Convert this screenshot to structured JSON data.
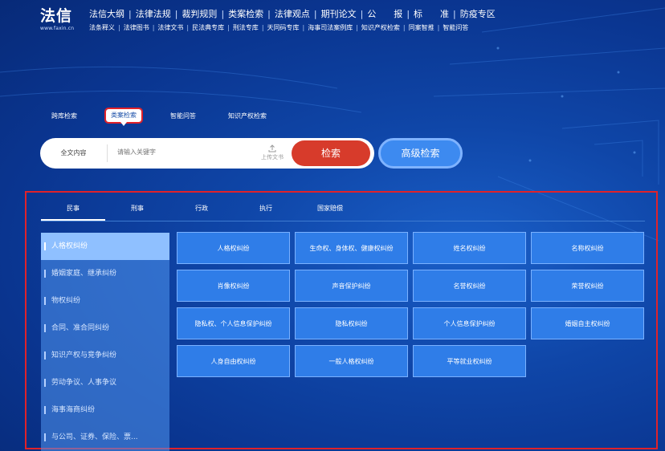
{
  "brand": {
    "name": "法信",
    "url": "www.faxin.cn"
  },
  "nav_main": [
    "法信大纲",
    "法律法规",
    "裁判规则",
    "类案检索",
    "法律观点",
    "期刊论文",
    "公　　报",
    "标　　准",
    "防疫专区"
  ],
  "nav_sub": [
    "法条释义",
    "法律图书",
    "法律文书",
    "民法典专库",
    "刑法专库",
    "天同码专库",
    "海事司法案例库",
    "知识产权检索",
    "同案智推",
    "智能问答"
  ],
  "search_tabs": [
    {
      "label": "跨库检索",
      "active": false
    },
    {
      "label": "类案检索",
      "active": true
    },
    {
      "label": "智能问答",
      "active": false
    },
    {
      "label": "知识产权检索",
      "active": false
    }
  ],
  "search": {
    "scope": "全文内容",
    "placeholder": "请输入关键字",
    "upload_label": "上传文书",
    "search_label": "检索",
    "advanced_label": "高级检索"
  },
  "category_tabs": [
    {
      "label": "民事",
      "active": true
    },
    {
      "label": "刑事",
      "active": false
    },
    {
      "label": "行政",
      "active": false
    },
    {
      "label": "执行",
      "active": false
    },
    {
      "label": "国家赔偿",
      "active": false
    }
  ],
  "side_items": [
    {
      "label": "人格权纠纷",
      "active": true
    },
    {
      "label": "婚姻家庭、继承纠纷",
      "active": false
    },
    {
      "label": "物权纠纷",
      "active": false
    },
    {
      "label": "合同、准合同纠纷",
      "active": false
    },
    {
      "label": "知识产权与竞争纠纷",
      "active": false
    },
    {
      "label": "劳动争议、人事争议",
      "active": false
    },
    {
      "label": "海事海商纠纷",
      "active": false
    },
    {
      "label": "与公司、证券、保险、票...",
      "active": false
    }
  ],
  "sub_categories": [
    "人格权纠纷",
    "生命权、身体权、健康权纠纷",
    "姓名权纠纷",
    "名称权纠纷",
    "肖像权纠纷",
    "声音保护纠纷",
    "名誉权纠纷",
    "荣誉权纠纷",
    "隐私权、个人信息保护纠纷",
    "隐私权纠纷",
    "个人信息保护纠纷",
    "婚姻自主权纠纷",
    "人身自由权纠纷",
    "一般人格权纠纷",
    "平等就业权纠纷"
  ],
  "colors": {
    "accent_red": "#d73b2b",
    "cell_blue": "#2f7de8",
    "highlight": "#e0222a"
  }
}
